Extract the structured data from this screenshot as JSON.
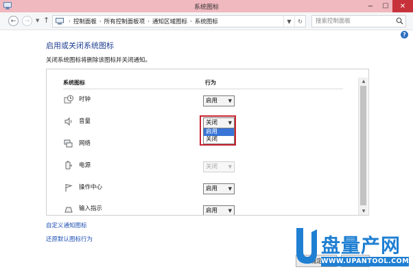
{
  "window": {
    "title": "系统图标"
  },
  "title_controls": {
    "minimize": "−",
    "maximize": "☐",
    "close": "✕"
  },
  "address_bar": {
    "crumbs": [
      "控制面板",
      "所有控制面板项",
      "通知区域图标",
      "系统图标"
    ],
    "separator": "›"
  },
  "search": {
    "placeholder": "搜索控制面板"
  },
  "help_label": "?",
  "main": {
    "heading": "启用或关闭系统图标",
    "description": "关闭系统图标将删除该图标并关闭通知。",
    "columns": {
      "icons": "系统图标",
      "behavior": "行为"
    },
    "rows": [
      {
        "label": "时钟",
        "value": "启用",
        "disabled": false,
        "icon": "clock-icon"
      },
      {
        "label": "音量",
        "value": "关闭",
        "disabled": false,
        "icon": "speaker-icon"
      },
      {
        "label": "网络",
        "value": "",
        "disabled": false,
        "icon": "network-icon"
      },
      {
        "label": "电源",
        "value": "关闭",
        "disabled": true,
        "icon": "power-icon"
      },
      {
        "label": "操作中心",
        "value": "启用",
        "disabled": false,
        "icon": "flag-icon"
      },
      {
        "label": "输入指示",
        "value": "启用",
        "disabled": false,
        "icon": "keyboard-icon"
      }
    ],
    "dropdown_open": {
      "options": [
        "启用",
        "关闭"
      ],
      "highlighted": "启用"
    },
    "links": {
      "customize": "自定义通知图标",
      "restore": "还原默认图标行为"
    }
  },
  "footer_buttons": {
    "ok": "确定",
    "cancel": "取消"
  },
  "watermark": {
    "brand": "盘量产网",
    "url": "WWW.UPANTOOL.COM"
  },
  "colors": {
    "titlebar": "#f0b8bf",
    "close_button": "#c7323a",
    "heading": "#1e3e90",
    "link": "#1e50b4",
    "highlight": "#3875d7",
    "callout_frame": "#c8212f",
    "watermark": "#1f7fd2"
  }
}
